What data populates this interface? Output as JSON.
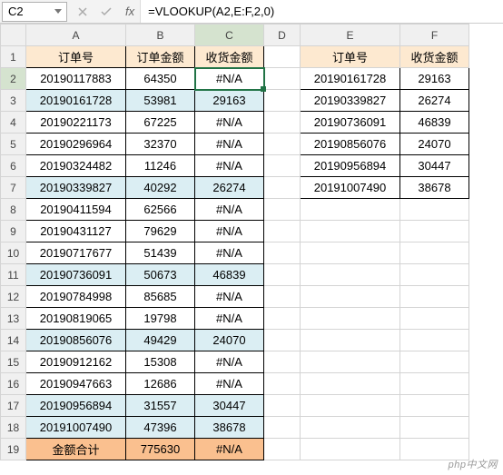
{
  "formula_bar": {
    "cell_ref": "C2",
    "formula": "=VLOOKUP(A2,E:F,2,0)"
  },
  "columns": [
    "A",
    "B",
    "C",
    "D",
    "E",
    "F"
  ],
  "rows": [
    "1",
    "2",
    "3",
    "4",
    "5",
    "6",
    "7",
    "8",
    "9",
    "10",
    "11",
    "12",
    "13",
    "14",
    "15",
    "16",
    "17",
    "18",
    "19"
  ],
  "main_headers": {
    "A": "订单号",
    "B": "订单金额",
    "C": "收货金额"
  },
  "lookup_headers": {
    "E": "订单号",
    "F": "收货金额"
  },
  "main_data": [
    {
      "order": "20190117883",
      "amount": "64350",
      "recv": "#N/A",
      "band": false
    },
    {
      "order": "20190161728",
      "amount": "53981",
      "recv": "29163",
      "band": true
    },
    {
      "order": "20190221173",
      "amount": "67225",
      "recv": "#N/A",
      "band": false
    },
    {
      "order": "20190296964",
      "amount": "32370",
      "recv": "#N/A",
      "band": false
    },
    {
      "order": "20190324482",
      "amount": "11246",
      "recv": "#N/A",
      "band": false
    },
    {
      "order": "20190339827",
      "amount": "40292",
      "recv": "26274",
      "band": true
    },
    {
      "order": "20190411594",
      "amount": "62566",
      "recv": "#N/A",
      "band": false
    },
    {
      "order": "20190431127",
      "amount": "79629",
      "recv": "#N/A",
      "band": false
    },
    {
      "order": "20190717677",
      "amount": "51439",
      "recv": "#N/A",
      "band": false
    },
    {
      "order": "20190736091",
      "amount": "50673",
      "recv": "46839",
      "band": true
    },
    {
      "order": "20190784998",
      "amount": "85685",
      "recv": "#N/A",
      "band": false
    },
    {
      "order": "20190819065",
      "amount": "19798",
      "recv": "#N/A",
      "band": false
    },
    {
      "order": "20190856076",
      "amount": "49429",
      "recv": "24070",
      "band": true
    },
    {
      "order": "20190912162",
      "amount": "15308",
      "recv": "#N/A",
      "band": false
    },
    {
      "order": "20190947663",
      "amount": "12686",
      "recv": "#N/A",
      "band": false
    },
    {
      "order": "20190956894",
      "amount": "31557",
      "recv": "30447",
      "band": true
    },
    {
      "order": "20191007490",
      "amount": "47396",
      "recv": "38678",
      "band": true
    }
  ],
  "totals": {
    "label": "金额合计",
    "amount": "775630",
    "recv": "#N/A"
  },
  "lookup_data": [
    {
      "order": "20190161728",
      "recv": "29163"
    },
    {
      "order": "20190339827",
      "recv": "26274"
    },
    {
      "order": "20190736091",
      "recv": "46839"
    },
    {
      "order": "20190856076",
      "recv": "24070"
    },
    {
      "order": "20190956894",
      "recv": "30447"
    },
    {
      "order": "20191007490",
      "recv": "38678"
    }
  ],
  "selected": {
    "col": "C",
    "row": "2"
  },
  "watermark": "php中文网"
}
